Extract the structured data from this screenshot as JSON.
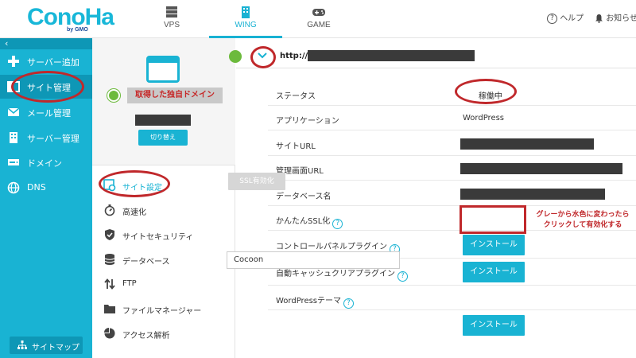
{
  "header": {
    "logo": "ConoHa",
    "logo_sub": "by GMO",
    "tabs": [
      {
        "label": "VPS",
        "icon": "server-stack-icon"
      },
      {
        "label": "WING",
        "icon": "building-icon"
      },
      {
        "label": "GAME",
        "icon": "gamepad-icon"
      }
    ],
    "help": "ヘルプ",
    "notice": "お知らせ"
  },
  "sidebar": {
    "items": [
      {
        "label": "サーバー追加",
        "icon": "plus-icon"
      },
      {
        "label": "サイト管理",
        "icon": "site-icon"
      },
      {
        "label": "メール管理",
        "icon": "mail-icon"
      },
      {
        "label": "サーバー管理",
        "icon": "server-icon"
      },
      {
        "label": "ドメイン",
        "icon": "domain-icon"
      },
      {
        "label": "DNS",
        "icon": "globe-icon"
      }
    ],
    "sitemap": "サイトマップ"
  },
  "site_card": {
    "domain_label": "取得した独自ドメイン",
    "switch_button": "切り替え"
  },
  "subnav": {
    "items": [
      {
        "label": "サイト設定",
        "icon": "settings-icon"
      },
      {
        "label": "高速化",
        "icon": "stopwatch-icon"
      },
      {
        "label": "サイトセキュリティ",
        "icon": "shield-icon"
      },
      {
        "label": "データベース",
        "icon": "database-icon"
      },
      {
        "label": "FTP",
        "icon": "transfer-icon"
      },
      {
        "label": "ファイルマネージャー",
        "icon": "folder-icon"
      },
      {
        "label": "アクセス解析",
        "icon": "pie-chart-icon"
      }
    ]
  },
  "main": {
    "url_prefix": "http://",
    "rows": {
      "status_label": "ステータス",
      "status_value": "稼働中",
      "app_label": "アプリケーション",
      "app_value": "WordPress",
      "url_label": "サイトURL",
      "admin_label": "管理画面URL",
      "db_label": "データベース名",
      "ssl_label": "かんたんSSL化",
      "ssl_button": "SSL有効化",
      "cpanel_label": "コントロールパネルプラグイン",
      "cpanel_button": "インストール",
      "cache_label": "自動キャッシュクリアプラグイン",
      "cache_button": "インストール",
      "theme_label": "WordPressテーマ",
      "theme_value": "Cocoon",
      "theme_button": "インストール"
    }
  },
  "annotation": {
    "ssl_line1": "グレーから水色に変わったら",
    "ssl_line2": "クリックして有効化する"
  },
  "colors": {
    "accent": "#19b3d3",
    "accent_dark": "#0e97b6",
    "highlight": "#c0282b",
    "status_green": "#6cba3c",
    "disabled": "#d6d6d6"
  }
}
